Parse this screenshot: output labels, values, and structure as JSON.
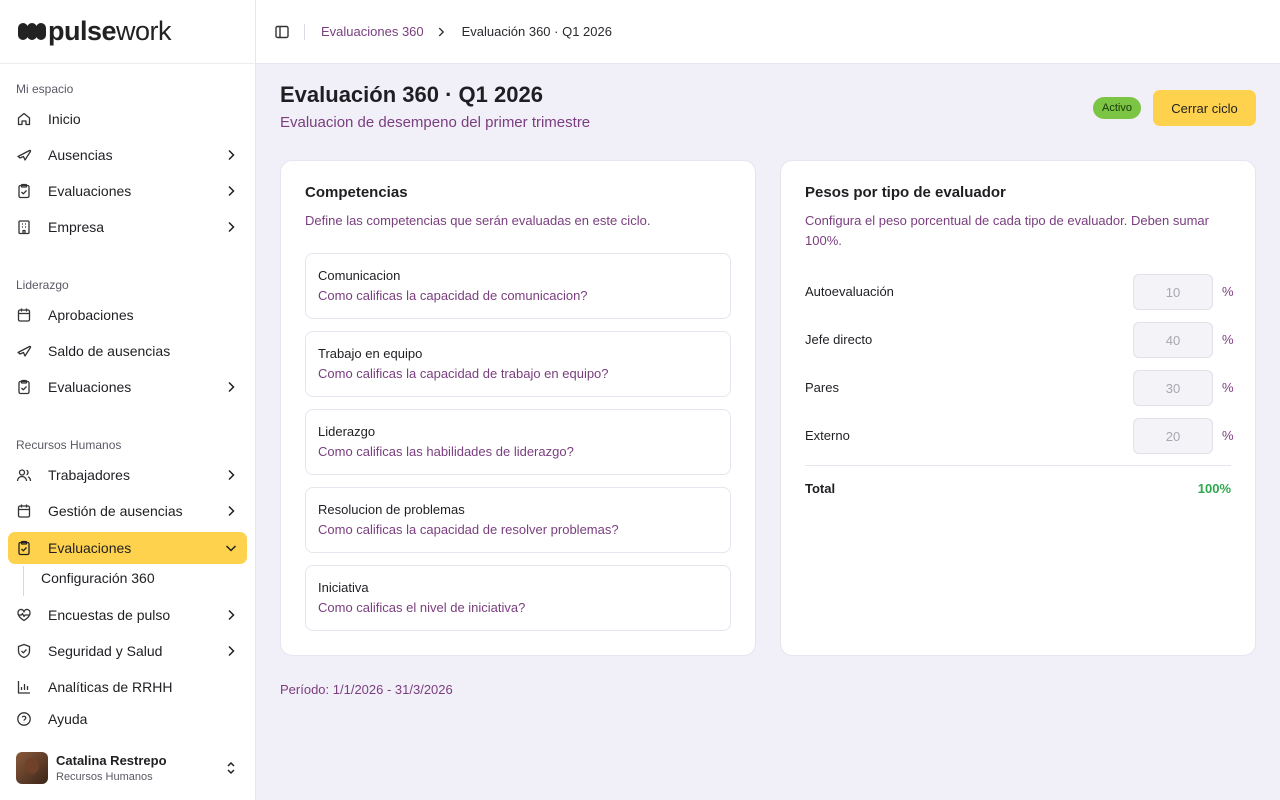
{
  "brand": {
    "name_bold": "pulse",
    "name_light": "work"
  },
  "sidebar": {
    "sections": {
      "mi_espacio": "Mi espacio",
      "liderazgo": "Liderazgo",
      "rrhh": "Recursos Humanos"
    },
    "items": {
      "inicio": "Inicio",
      "ausencias": "Ausencias",
      "evaluaciones_1": "Evaluaciones",
      "empresa": "Empresa",
      "aprobaciones": "Aprobaciones",
      "saldo": "Saldo de ausencias",
      "evaluaciones_2": "Evaluaciones",
      "trabajadores": "Trabajadores",
      "gestion": "Gestión de ausencias",
      "evaluaciones_3": "Evaluaciones",
      "configuracion": "Configuración 360",
      "encuestas": "Encuestas de pulso",
      "seguridad": "Seguridad y Salud",
      "analiticas": "Analíticas de RRHH",
      "ayuda": "Ayuda"
    },
    "user": {
      "name": "Catalina Restrepo",
      "role": "Recursos Humanos"
    }
  },
  "breadcrumb": {
    "parent": "Evaluaciones 360",
    "current": "Evaluación 360 · Q1 2026"
  },
  "header": {
    "title": "Evaluación 360 · Q1 2026",
    "subtitle": "Evaluacion de desempeno del primer trimestre",
    "status": "Activo",
    "action": "Cerrar ciclo"
  },
  "competencias": {
    "title": "Competencias",
    "description": "Define las competencias que serán evaluadas en este ciclo.",
    "items": [
      {
        "name": "Comunicacion",
        "question": "Como calificas la capacidad de comunicacion?"
      },
      {
        "name": "Trabajo en equipo",
        "question": "Como calificas la capacidad de trabajo en equipo?"
      },
      {
        "name": "Liderazgo",
        "question": "Como calificas las habilidades de liderazgo?"
      },
      {
        "name": "Resolucion de problemas",
        "question": "Como calificas la capacidad de resolver problemas?"
      },
      {
        "name": "Iniciativa",
        "question": "Como calificas el nivel de iniciativa?"
      }
    ]
  },
  "pesos": {
    "title": "Pesos por tipo de evaluador",
    "description": "Configura el peso porcentual de cada tipo de evaluador. Deben sumar 100%.",
    "unit": "%",
    "rows": [
      {
        "label": "Autoevaluación",
        "value": "10"
      },
      {
        "label": "Jefe directo",
        "value": "40"
      },
      {
        "label": "Pares",
        "value": "30"
      },
      {
        "label": "Externo",
        "value": "20"
      }
    ],
    "total_label": "Total",
    "total_value": "100%"
  },
  "period": "Período: 1/1/2026 - 31/3/2026",
  "colors": {
    "accent": "#ffd24d",
    "link": "#7a3e7f",
    "success": "#2ea84e",
    "badge": "#7cc443"
  }
}
